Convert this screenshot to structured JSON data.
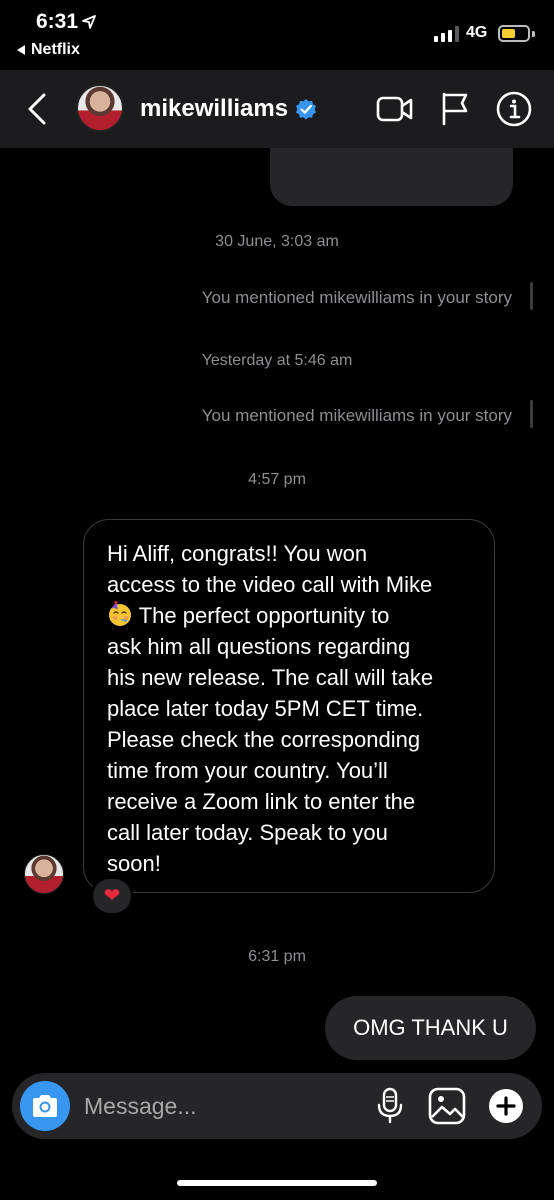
{
  "status_bar": {
    "time": "6:31",
    "back_app": "Netflix",
    "network": "4G",
    "battery_level": 0.55,
    "battery_color": "#f5cf2e"
  },
  "header": {
    "username": "mikewilliams",
    "verified": true,
    "icons": [
      "back-chevron-icon",
      "video-call-icon",
      "flag-icon",
      "info-icon"
    ],
    "accent": "#3797f0"
  },
  "messages": {
    "timestamp_1": "30 June, 3:03 am",
    "mention_1": "You mentioned mikewilliams in your story",
    "timestamp_2": "Yesterday at 5:46 am",
    "mention_2": "You mentioned mikewilliams in your story",
    "timestamp_3": "4:57 pm",
    "incoming_lines": [
      "Hi Aliff, congrats!! You won",
      "access to the video call with Mike",
      "The perfect opportunity to",
      "ask him all questions regarding",
      "his new release. The call will take",
      "place later today 5PM CET time.",
      "Please check the corresponding",
      "time from your country. You’ll",
      "receive a Zoom link to enter the",
      "call later today. Speak to you",
      "soon!"
    ],
    "incoming_emoji": "partying-face-emoji",
    "reaction": "❤",
    "timestamp_4": "6:31 pm",
    "outgoing_text": "OMG THANK U"
  },
  "composer": {
    "placeholder": "Message...",
    "icons": [
      "camera-icon",
      "microphone-icon",
      "gallery-icon",
      "plus-icon"
    ]
  }
}
